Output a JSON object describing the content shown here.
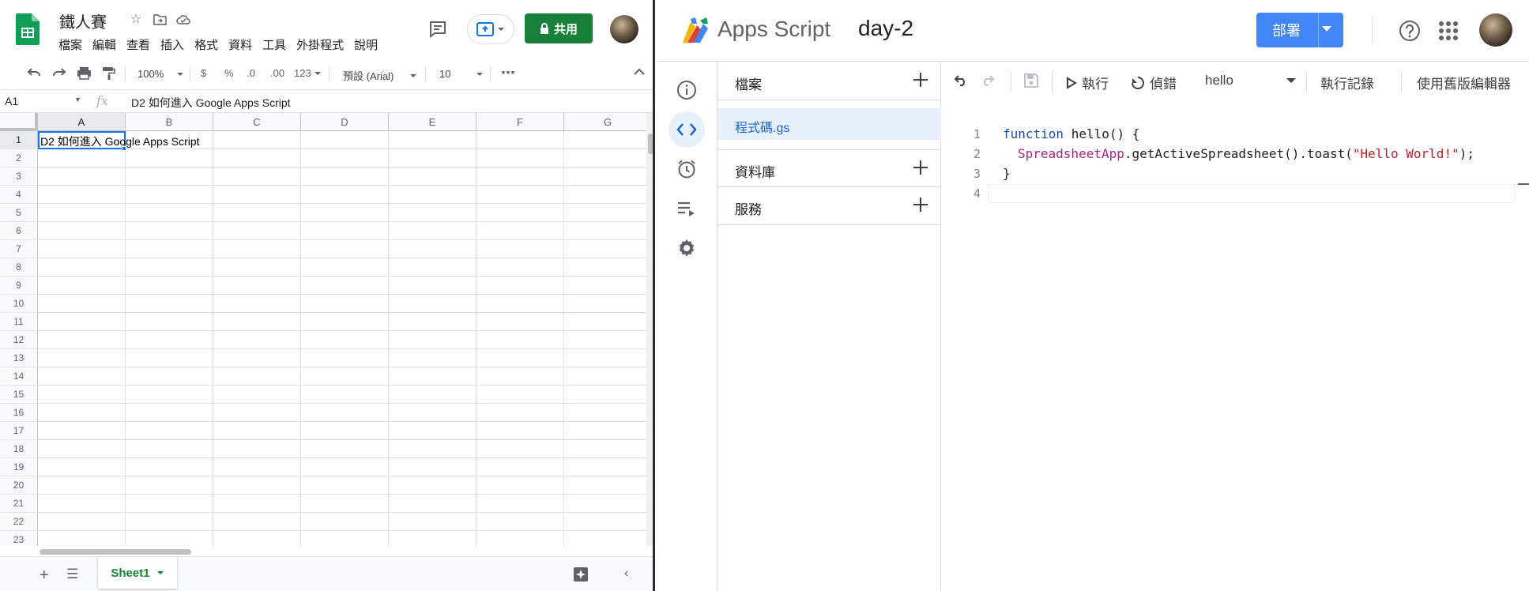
{
  "sheets": {
    "title": "鐵人賽",
    "menu": [
      "檔案",
      "編輯",
      "查看",
      "插入",
      "格式",
      "資料",
      "工具",
      "外掛程式",
      "說明"
    ],
    "share_label": "共用",
    "toolbar": {
      "zoom": "100%",
      "currency": "$",
      "percent": "%",
      "dec_decrease": ".0",
      "dec_increase": ".00",
      "more_formats": "123",
      "font": "預設 (Arial)",
      "font_size": "10",
      "more": "⋯"
    },
    "name_box": "A1",
    "fx": "fx",
    "formula": "D2 如何進入 Google Apps Script",
    "columns": [
      "A",
      "B",
      "C",
      "D",
      "E",
      "F",
      "G"
    ],
    "rows": [
      "1",
      "2",
      "3",
      "4",
      "5",
      "6",
      "7",
      "8",
      "9",
      "10",
      "11",
      "12",
      "13",
      "14",
      "15",
      "16",
      "17",
      "18",
      "19",
      "20",
      "21",
      "22",
      "23"
    ],
    "cell_a1": "D2 如何進入 Google Apps Script",
    "sheet_tab": "Sheet1"
  },
  "apps_script": {
    "brand": "Apps Script",
    "project": "day-2",
    "deploy_label": "部署",
    "files": {
      "section_files": "檔案",
      "file_name": "程式碼.gs",
      "section_libraries": "資料庫",
      "section_services": "服務"
    },
    "toolbar": {
      "run": "執行",
      "debug": "偵錯",
      "function": "hello",
      "log": "執行記錄",
      "legacy": "使用舊版編輯器"
    },
    "code": {
      "line_numbers": [
        "1",
        "2",
        "3",
        "4"
      ],
      "line1_kw": "function",
      "line1_rest": " hello() {",
      "line2_cls": "SpreadsheetApp",
      "line2_mid": ".getActiveSpreadsheet().toast(",
      "line2_str": "\"Hello World!\"",
      "line2_end": ");",
      "line3": "}"
    }
  },
  "colors": {
    "sheets_green": "#188038",
    "deploy_blue": "#4285f4",
    "selection_blue": "#1a73e8",
    "active_file_bg": "#e8f0fe"
  },
  "icons": [
    "sheets-logo-icon",
    "star-icon",
    "move-folder-icon",
    "cloud-status-icon",
    "comment-icon",
    "present-icon",
    "lock-icon",
    "undo-icon",
    "redo-icon",
    "print-icon",
    "paint-format-icon",
    "apps-script-logo-icon",
    "help-icon",
    "apps-grid-icon",
    "info-icon",
    "code-icon",
    "clock-icon",
    "executions-icon",
    "gear-icon",
    "plus-icon",
    "save-icon",
    "play-icon",
    "debug-icon"
  ]
}
